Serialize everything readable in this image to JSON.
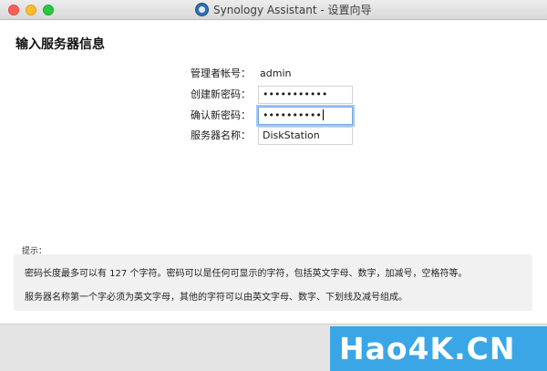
{
  "window": {
    "title": "Synology Assistant - 设置向导",
    "app_icon": "synology-assistant-icon",
    "traffic_lights": {
      "close": "#fc5f57",
      "minimize": "#fdbc2e",
      "maximize": "#29c841"
    }
  },
  "page": {
    "heading": "输入服务器信息"
  },
  "form": {
    "admin_account": {
      "label": "管理者帐号：",
      "value": "admin"
    },
    "new_password": {
      "label": "创建新密码：",
      "value": "•••••••••••"
    },
    "confirm_password": {
      "label": "确认新密码：",
      "value": "••••••••••"
    },
    "server_name": {
      "label": "服务器名称：",
      "value": "DiskStation"
    }
  },
  "hints": {
    "label": "提示：",
    "line1": "密码长度最多可以有 127 个字符。密码可以是任何可显示的字符，包括英文字母、数字，加减号，空格符等。",
    "line2": "服务器名称第一个字必须为英文字母，其他的字符可以由英文字母、数字、下划线及减号组成。"
  },
  "watermark": {
    "text": "Hao4K.CN",
    "color": "#3aa6e6"
  },
  "colors": {
    "focus_ring": "#a6c6f0",
    "hint_background": "#f1f1f1",
    "footer_background": "#e4e4e4"
  }
}
